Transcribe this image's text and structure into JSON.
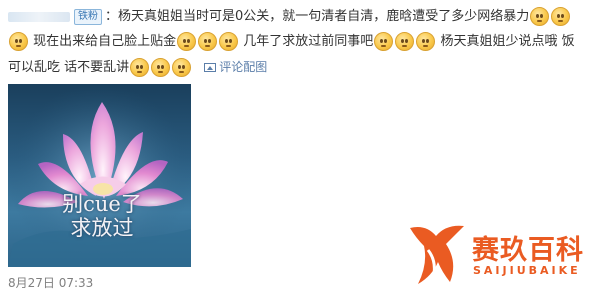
{
  "post": {
    "user_badge": "铁粉",
    "line1_text": "：杨天真姐姐当时可是0公关，就一句清者自清，鹿晗遭受了多少网络暴力",
    "line2_a": "现在出来给自己脸上贴金",
    "line2_b": "几年了求放过前同事吧",
    "line2_c": "杨天真姐姐少说点哦 饭",
    "line3_text": "可以乱吃 话不要乱讲",
    "reply_link": "评论配图",
    "timestamp": "8月27日 07:33"
  },
  "image": {
    "caption_line1": "别cue了",
    "caption_line2": "求放过"
  },
  "watermark": {
    "brand_cn": "赛玖百科",
    "brand_en": "SAIJIUBAIKE"
  },
  "colors": {
    "link": "#5b7ea9",
    "badge_border": "#8bb6db",
    "watermark": "#ea5b22"
  },
  "icons": [
    "emoji-icon",
    "image-icon",
    "lotus-photo",
    "brand-logo"
  ]
}
